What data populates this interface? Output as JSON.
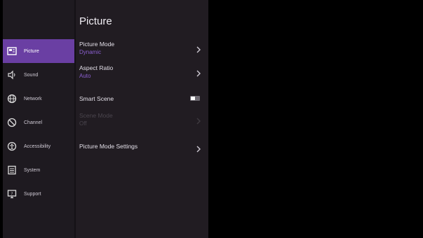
{
  "nav": {
    "items": [
      {
        "label": "Picture",
        "icon": "picture-icon"
      },
      {
        "label": "Sound",
        "icon": "speaker-icon"
      },
      {
        "label": "Network",
        "icon": "globe-icon"
      },
      {
        "label": "Channel",
        "icon": "channel-icon"
      },
      {
        "label": "Accessibility",
        "icon": "accessibility-icon"
      },
      {
        "label": "System",
        "icon": "system-icon"
      },
      {
        "label": "Support",
        "icon": "support-icon"
      }
    ],
    "active_index": 0
  },
  "panel": {
    "title": "Picture",
    "picture_mode": {
      "label": "Picture Mode",
      "value": "Dynamic"
    },
    "aspect_ratio": {
      "label": "Aspect Ratio",
      "value": "Auto"
    },
    "smart_scene": {
      "label": "Smart Scene",
      "enabled": false
    },
    "scene_mode": {
      "label": "Scene Mode",
      "value": "Off",
      "disabled": true
    },
    "picture_mode_settings": {
      "label": "Picture Mode Settings"
    }
  },
  "colors": {
    "accent": "#6a3fa3",
    "value_text": "#8b5fd0",
    "nav_bg": "#1e1a20",
    "panel_bg": "#211c22"
  }
}
